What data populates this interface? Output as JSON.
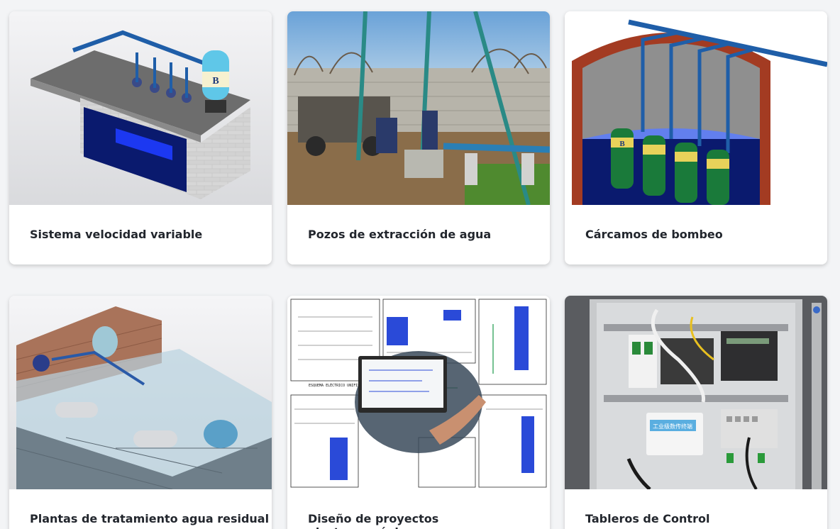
{
  "cards": [
    {
      "title": "Sistema velocidad variable",
      "logo_letter": "B",
      "accent": "#1f5ea8"
    },
    {
      "title": "Pozos de extracción de agua",
      "accent": "#2a7fb5"
    },
    {
      "title": "Cárcamos de bombeo",
      "logo_letter": "B",
      "accent": "#1a7a3a"
    },
    {
      "title": "Plantas de tratamiento agua residual",
      "accent": "#5aa0c8"
    },
    {
      "title": "Diseño de proyectos electromecánicos",
      "drawing_label": "ESQUEMA ELÉCTRICO UNIFILAR"
    },
    {
      "title": "Tableros de Control",
      "module_label": "工业级数传终端"
    }
  ]
}
